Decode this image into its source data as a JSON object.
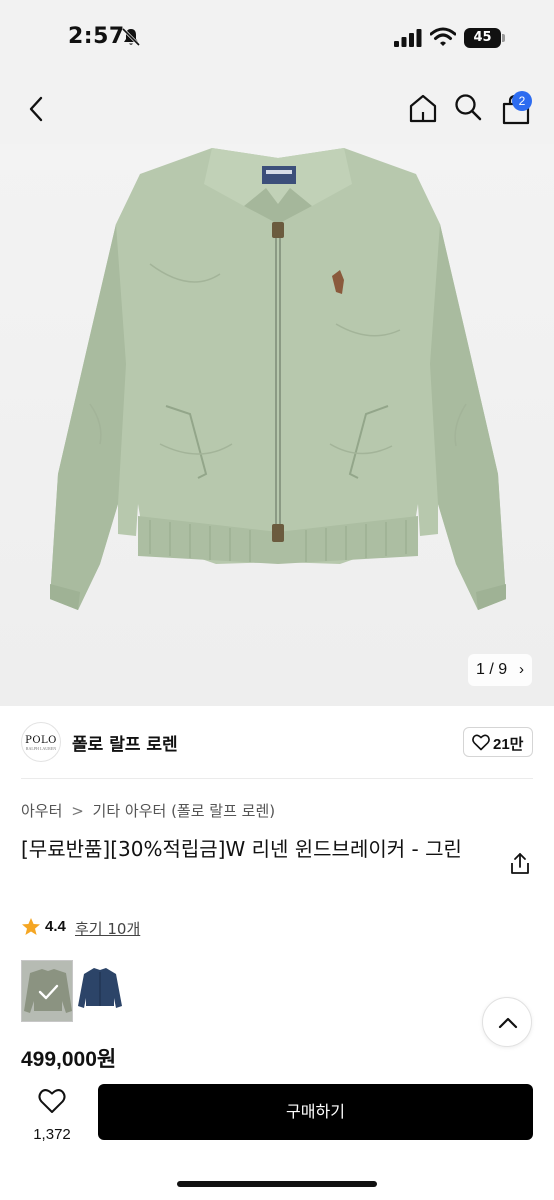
{
  "status_bar": {
    "time": "2:57",
    "battery": "45",
    "icons": [
      "bell-off-icon",
      "signal-icon",
      "wifi-icon",
      "battery-icon"
    ]
  },
  "header": {
    "icons": [
      "chevron-left-icon",
      "home-icon",
      "search-icon",
      "shopping-bag-icon"
    ],
    "cart_count": "2"
  },
  "gallery": {
    "counter": "1 / 9",
    "next_glyph": "›"
  },
  "brand": {
    "logo_text": "POLO",
    "logo_subtext": "RALPH LAUREN",
    "name": "폴로 랄프 로렌",
    "likes": "21만"
  },
  "breadcrumb": {
    "items": [
      "아우터",
      "기타 아우터 (폴로 랄프 로렌)"
    ],
    "separator": ">"
  },
  "product": {
    "title": "[무료반품][30%적립금]W 리넨 윈드브레이커 - 그린",
    "rating": "4.4",
    "review_label": "후기 10개",
    "price": "499,000원"
  },
  "swatches": [
    {
      "name": "green",
      "color": "#b8c7ad",
      "selected": true
    },
    {
      "name": "navy",
      "color": "#2c4468",
      "selected": false
    }
  ],
  "bottom_bar": {
    "wish_count": "1,372",
    "buy_label": "구매하기"
  },
  "colors": {
    "accent_badge": "#2d6cf0",
    "star": "#f5a623",
    "buy_button": "#000000"
  }
}
